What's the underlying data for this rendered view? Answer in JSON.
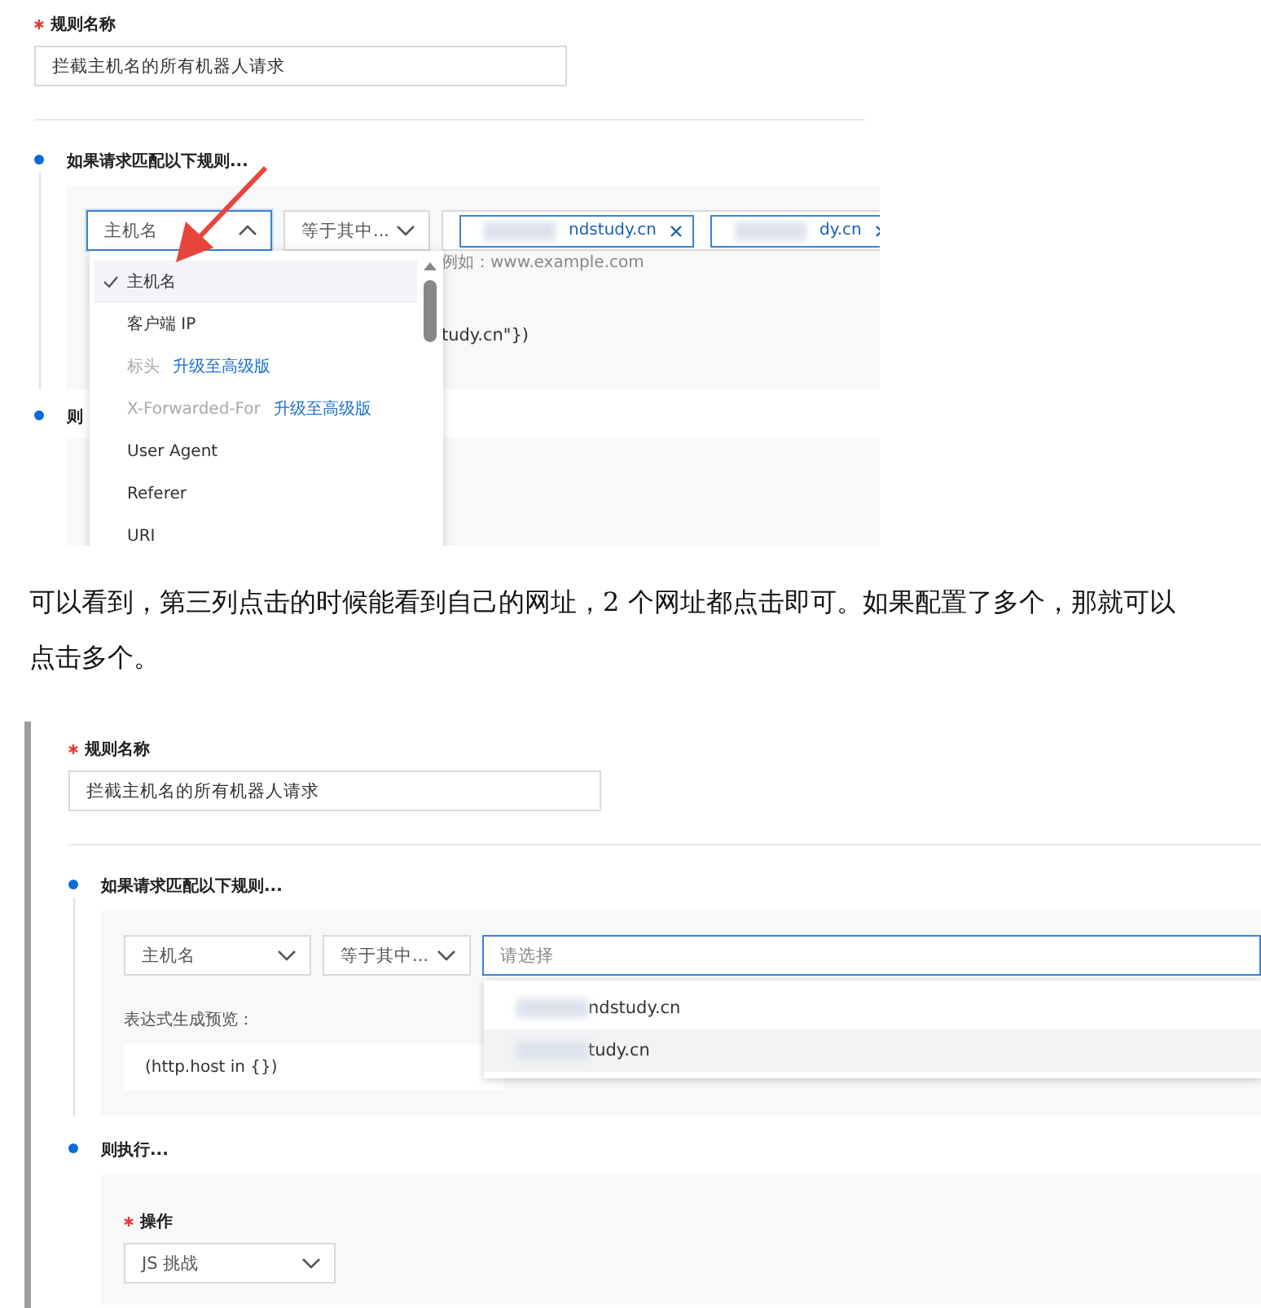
{
  "top_screenshot": {
    "rule_name": {
      "label": "规则名称",
      "required": true,
      "value": "拦截主机名的所有机器人请求"
    },
    "if_step": {
      "label": "如果请求匹配以下规则..."
    },
    "field_select": {
      "value": "主机名",
      "expanded": true
    },
    "operator_select": {
      "value": "等于其中...",
      "expanded": false
    },
    "host_tags": [
      {
        "text": "ndstudy.cn"
      },
      {
        "text": "dy.cn"
      }
    ],
    "hint": "例如：www.example.com",
    "preview_fragment": "tudy.cn\"})",
    "then_step": {
      "label": "则"
    },
    "field_options": [
      {
        "label": "主机名",
        "selected": true,
        "disabled": false
      },
      {
        "label": "客户端 IP",
        "selected": false,
        "disabled": false
      },
      {
        "label": "标头",
        "selected": false,
        "disabled": true,
        "upgrade_link": "升级至高级版"
      },
      {
        "label": "X-Forwarded-For",
        "selected": false,
        "disabled": true,
        "upgrade_link": "升级至高级版"
      },
      {
        "label": "User Agent",
        "selected": false,
        "disabled": false
      },
      {
        "label": "Referer",
        "selected": false,
        "disabled": false
      },
      {
        "label": "URI",
        "selected": false,
        "disabled": false
      }
    ]
  },
  "paragraph": "可以看到，第三列点击的时候能看到自己的网址，2 个网址都点击即可。如果配置了多个，那就可以点击多个。",
  "bottom_screenshot": {
    "rule_name": {
      "label": "规则名称",
      "required": true,
      "value": "拦截主机名的所有机器人请求"
    },
    "if_step": {
      "label": "如果请求匹配以下规则..."
    },
    "field_select": {
      "value": "主机名",
      "expanded": false
    },
    "operator_select": {
      "value": "等于其中...",
      "expanded": false
    },
    "value_select": {
      "placeholder": "请选择",
      "focused": true
    },
    "value_options": [
      {
        "text": "ndstudy.cn",
        "highlighted": false
      },
      {
        "text": "tudy.cn",
        "highlighted": true
      }
    ],
    "preview": {
      "label": "表达式生成预览：",
      "expression": "(http.host in {})"
    },
    "then_step": {
      "label": "则执行..."
    },
    "action": {
      "label": "操作",
      "required": true,
      "value": "JS 挑战"
    }
  }
}
